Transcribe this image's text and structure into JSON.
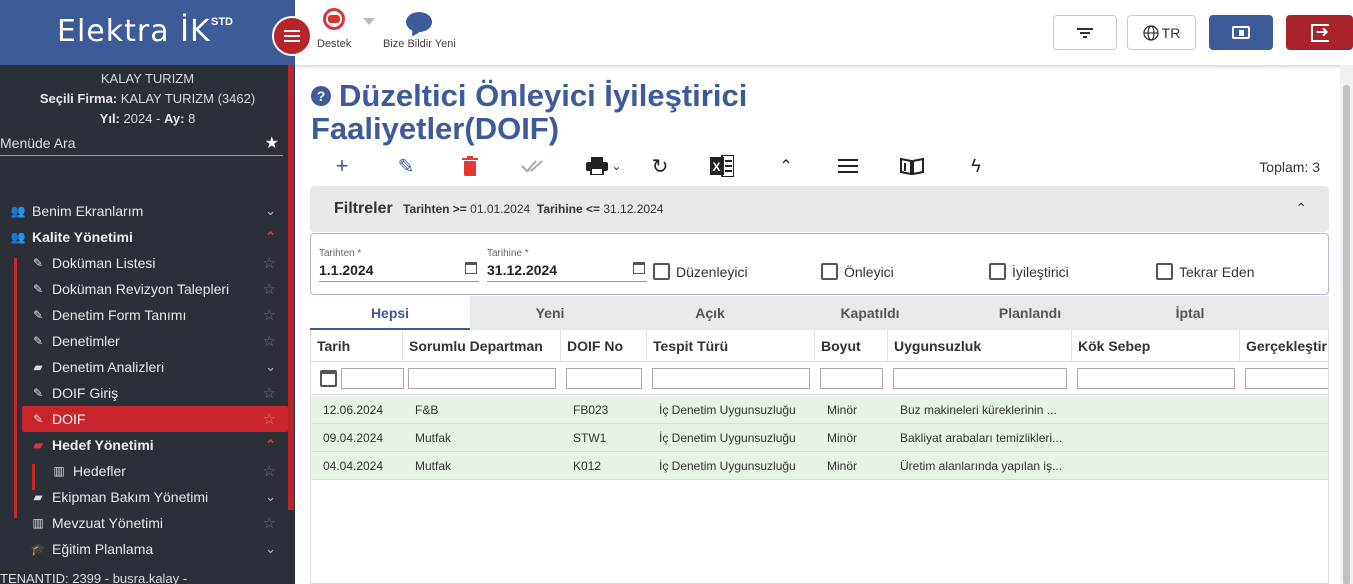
{
  "app": {
    "brand": "Elektra İK",
    "brand_sup": "STD"
  },
  "company": {
    "name": "KALAY TURIZM",
    "selected_label": "Seçili Firma:",
    "selected_value": "KALAY TURIZM (3462)",
    "year_label": "Yıl:",
    "year": "2024",
    "month_label": "Ay:",
    "month": "8"
  },
  "sidebar": {
    "search_label": "Menüde Ara",
    "items": [
      {
        "label": "Benim Ekranlarım"
      },
      {
        "label": "Kalite Yönetimi"
      },
      {
        "label": "Doküman Listesi"
      },
      {
        "label": "Doküman Revizyon Talepleri"
      },
      {
        "label": "Denetim Form Tanımı"
      },
      {
        "label": "Denetimler"
      },
      {
        "label": "Denetim Analizleri"
      },
      {
        "label": "DOIF Giriş"
      },
      {
        "label": "DOIF"
      },
      {
        "label": "Hedef Yönetimi"
      },
      {
        "label": "Hedefler"
      },
      {
        "label": "Ekipman Bakım Yönetimi"
      },
      {
        "label": "Mevzuat Yönetimi"
      },
      {
        "label": "Eğitim Planlama"
      }
    ],
    "tenant": "TENANTID: 2399 - busra.kalay -"
  },
  "topbar": {
    "destek": "Destek",
    "bize_bildir": "Bize Bildir Yeni",
    "lang": "TR"
  },
  "page": {
    "title": "Düzeltici Önleyici İyileştirici Faaliyetler(DOIF)",
    "total": "Toplam: 3"
  },
  "filters": {
    "title": "Filtreler",
    "desc_from_label": "Tarihten >=",
    "desc_from_value": "01.01.2024",
    "desc_to_label": "Tarihine <=",
    "desc_to_value": "31.12.2024",
    "from_label": "Tarihten *",
    "from_value": "1.1.2024",
    "to_label": "Tarihine *",
    "to_value": "31.12.2024",
    "checkboxes": [
      "Düzenleyici",
      "Önleyici",
      "İyileştirici",
      "Tekrar Eden"
    ]
  },
  "tabs": [
    "Hepsi",
    "Yeni",
    "Açık",
    "Kapatıldı",
    "Planlandı",
    "İptal"
  ],
  "grid": {
    "columns": [
      "Tarih",
      "Sorumlu Departman",
      "DOIF No",
      "Tespit Türü",
      "Boyut",
      "Uygunsuzluk",
      "Kök Sebep",
      "Gerçekleştirile"
    ],
    "rows": [
      [
        "12.06.2024",
        "F&B",
        "FB023",
        "İç Denetim Uygunsuzluğu",
        "Minör",
        "Buz makineleri küreklerinin ..."
      ],
      [
        "09.04.2024",
        "Mutfak",
        "STW1",
        "İç Denetim Uygunsuzluğu",
        "Minör",
        "Bakliyat arabaları temizlikleri..."
      ],
      [
        "04.04.2024",
        "Mutfak",
        "K012",
        "İç Denetim Uygunsuzluğu",
        "Minör",
        "Üretim alanlarında yapılan iş..."
      ]
    ]
  }
}
